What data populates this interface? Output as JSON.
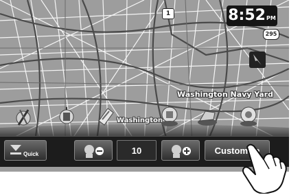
{
  "status": {
    "time": "8:52",
    "ampm": "PM"
  },
  "map": {
    "labels": {
      "area_name": "Washington Navy Yard",
      "city_name": "Washington"
    },
    "route_badges": {
      "north": "1",
      "east": "295"
    }
  },
  "toolbar": {
    "quick_label": "Quick",
    "volume_value": "10",
    "customize_label": "Customize"
  },
  "icons": {
    "quick": "quick-menu-icon",
    "voice_down": "voice-guide-down-icon",
    "voice_up": "voice-guide-up-icon",
    "compass": "compass-icon",
    "pois": [
      "restaurant-icon",
      "gas-station-icon",
      "parking-icon",
      "auto-service-icon",
      "hotel-icon",
      "atm-icon"
    ]
  }
}
